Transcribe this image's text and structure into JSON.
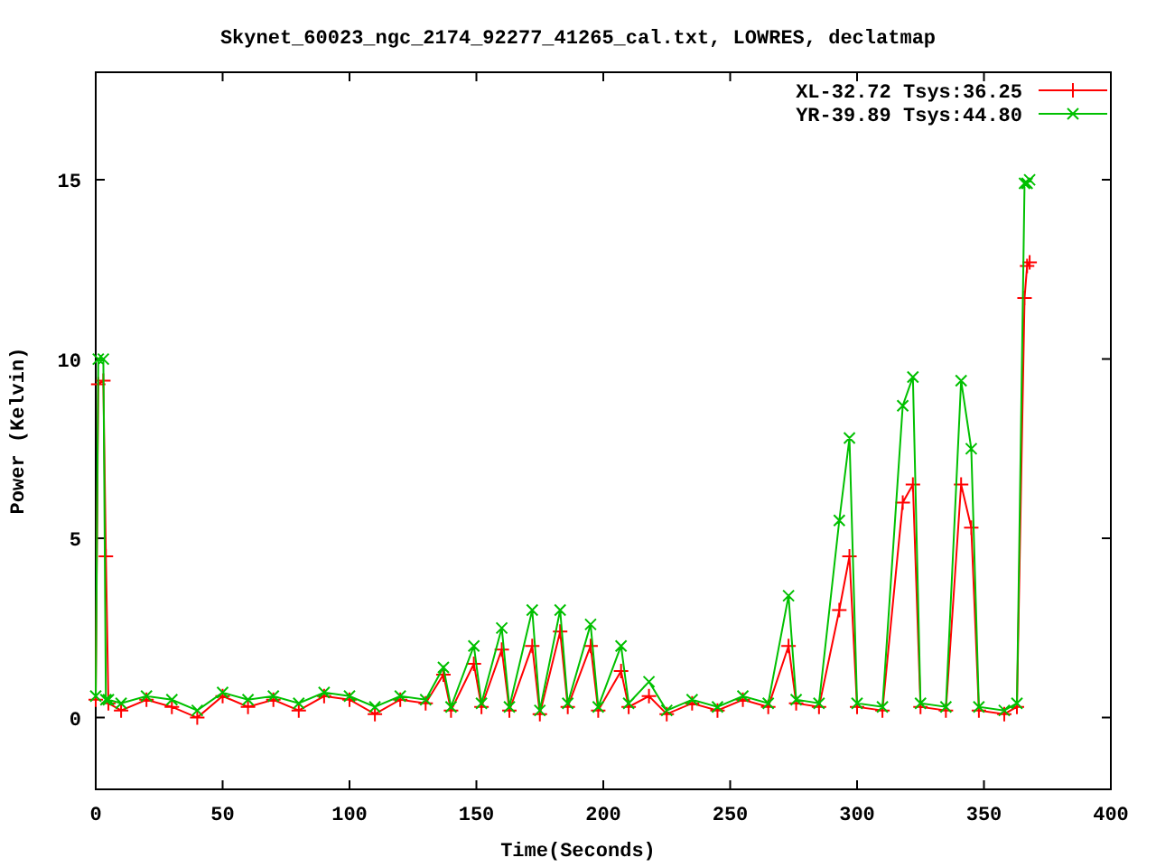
{
  "chart_data": {
    "type": "line",
    "title": "Skynet_60023_ngc_2174_92277_41265_cal.txt, LOWRES, declatmap",
    "xlabel": "Time(Seconds)",
    "ylabel": "Power (Kelvin)",
    "x": [
      0,
      1,
      3,
      4,
      5,
      10,
      20,
      30,
      40,
      50,
      60,
      70,
      80,
      90,
      100,
      110,
      120,
      130,
      137,
      140,
      149,
      152,
      160,
      163,
      172,
      175,
      183,
      186,
      195,
      198,
      207,
      210,
      218,
      225,
      235,
      245,
      255,
      265,
      273,
      276,
      285,
      293,
      297,
      300,
      310,
      318,
      322,
      325,
      335,
      341,
      345,
      348,
      358,
      363,
      366,
      367,
      368
    ],
    "series": [
      {
        "name": "XL-32.72 Tsys:36.25",
        "color": "#ff0000",
        "marker": "plus",
        "values": [
          0.5,
          9.3,
          9.4,
          4.5,
          0.4,
          0.2,
          0.5,
          0.3,
          0.0,
          0.6,
          0.3,
          0.5,
          0.2,
          0.6,
          0.5,
          0.1,
          0.5,
          0.4,
          1.2,
          0.2,
          1.5,
          0.3,
          1.9,
          0.2,
          2.0,
          0.1,
          2.4,
          0.3,
          2.0,
          0.2,
          1.3,
          0.3,
          0.6,
          0.1,
          0.4,
          0.2,
          0.5,
          0.3,
          2.0,
          0.4,
          0.3,
          3.0,
          4.5,
          0.3,
          0.2,
          6.0,
          6.5,
          0.3,
          0.2,
          6.5,
          5.3,
          0.2,
          0.1,
          0.3,
          11.7,
          12.6,
          12.7
        ]
      },
      {
        "name": "YR-39.89 Tsys:44.80",
        "color": "#00c000",
        "marker": "cross",
        "values": [
          0.6,
          10.0,
          10.0,
          0.5,
          0.5,
          0.4,
          0.6,
          0.5,
          0.2,
          0.7,
          0.5,
          0.6,
          0.4,
          0.7,
          0.6,
          0.3,
          0.6,
          0.5,
          1.4,
          0.3,
          2.0,
          0.4,
          2.5,
          0.3,
          3.0,
          0.2,
          3.0,
          0.4,
          2.6,
          0.3,
          2.0,
          0.4,
          1.0,
          0.2,
          0.5,
          0.3,
          0.6,
          0.4,
          3.4,
          0.5,
          0.4,
          5.5,
          7.8,
          0.4,
          0.3,
          8.7,
          9.5,
          0.4,
          0.3,
          9.4,
          7.5,
          0.3,
          0.2,
          0.4,
          14.9,
          14.9,
          15.0
        ]
      }
    ],
    "legend": true,
    "xlim": [
      0,
      400
    ],
    "ylim": [
      -2,
      18
    ],
    "xticks": [
      0,
      50,
      100,
      150,
      200,
      250,
      300,
      350,
      400
    ],
    "yticks": [
      0,
      5,
      10,
      15
    ]
  }
}
